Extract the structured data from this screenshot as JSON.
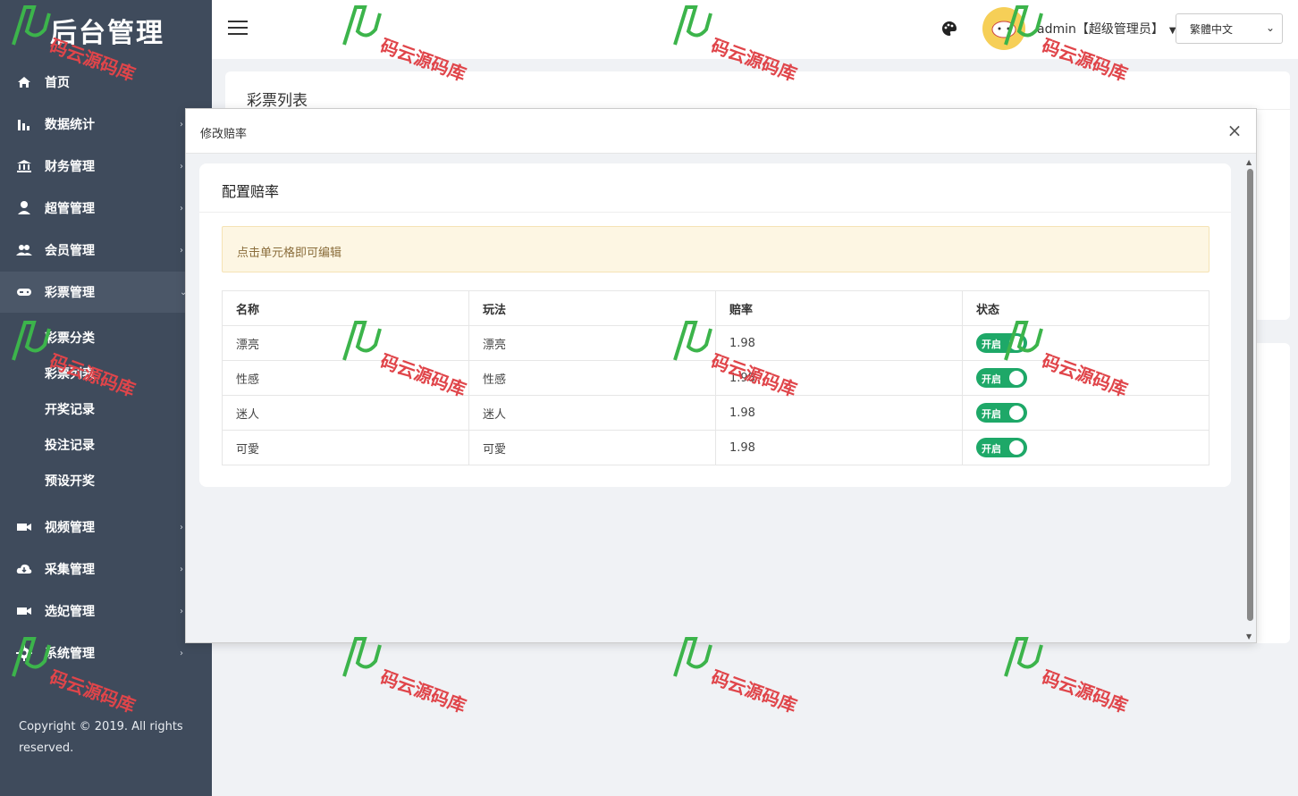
{
  "sidebar": {
    "brand": "后台管理",
    "items": [
      {
        "label": "首页",
        "icon": "home-icon"
      },
      {
        "label": "数据统计",
        "icon": "bar-chart-icon"
      },
      {
        "label": "财务管理",
        "icon": "bank-icon"
      },
      {
        "label": "超管管理",
        "icon": "user-icon"
      },
      {
        "label": "会员管理",
        "icon": "users-icon"
      },
      {
        "label": "彩票管理",
        "icon": "gamepad-icon"
      },
      {
        "label": "视频管理",
        "icon": "video-icon"
      },
      {
        "label": "采集管理",
        "icon": "cloud-download-icon"
      },
      {
        "label": "选妃管理",
        "icon": "video-icon"
      },
      {
        "label": "系统管理",
        "icon": "gear-icon"
      }
    ],
    "sub_items": [
      "彩票分类",
      "彩票列表",
      "开奖记录",
      "投注记录",
      "预设开奖"
    ],
    "copyright": "Copyright © 2019. All rights reserved."
  },
  "header": {
    "user": "admin【超级管理员】",
    "language": "繁體中文"
  },
  "page": {
    "card_title": "彩票列表"
  },
  "modal": {
    "title": "修改赔率",
    "card_title": "配置赔率",
    "alert": "点击单元格即可编辑",
    "columns": [
      "名称",
      "玩法",
      "赔率",
      "状态"
    ],
    "rows": [
      {
        "name": "漂亮",
        "play": "漂亮",
        "odds": "1.98",
        "status": "开启"
      },
      {
        "name": "性感",
        "play": "性感",
        "odds": "1.98",
        "status": "开启"
      },
      {
        "name": "迷人",
        "play": "迷人",
        "odds": "1.98",
        "status": "开启"
      },
      {
        "name": "可愛",
        "play": "可愛",
        "odds": "1.98",
        "status": "开启"
      }
    ]
  },
  "watermark": {
    "text": "码云源码库"
  },
  "colors": {
    "sidebar": "#3f4b5c",
    "switch_on": "#1ea868",
    "alert_bg": "#fdf6e3"
  }
}
